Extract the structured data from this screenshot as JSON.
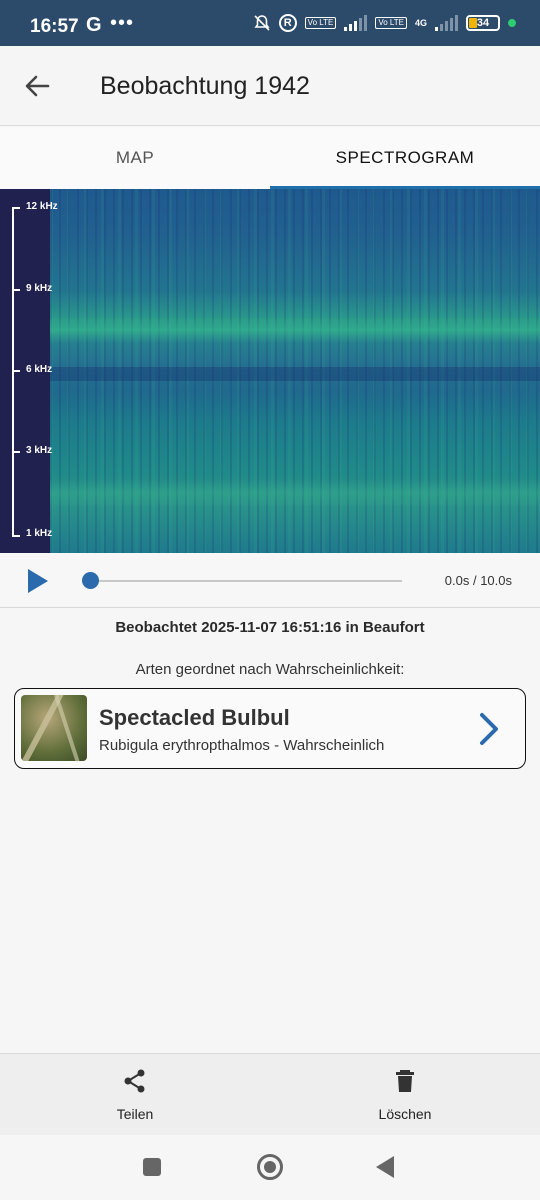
{
  "status_bar": {
    "time": "16:57",
    "app_icon": "G",
    "more": "•••",
    "r_badge": "R",
    "volte1": "Vo LTE",
    "volte2": "Vo LTE",
    "network": "4G",
    "battery": "34"
  },
  "app_bar": {
    "title": "Beobachtung 1942",
    "back_icon": "arrow-left-icon"
  },
  "tabs": [
    {
      "label": "MAP",
      "active": false
    },
    {
      "label": "SPECTROGRAM",
      "active": true
    }
  ],
  "spectrogram": {
    "frequency_labels": [
      "12 kHz",
      "9 kHz",
      "6 kHz",
      "3 kHz",
      "1 kHz"
    ]
  },
  "player": {
    "time": "0.0s / 10.0s",
    "progress": 0.0
  },
  "observation": {
    "observed_text": "Beobachtet 2025-11-07 16:51:16 in Beaufort",
    "sorted_label": "Arten geordnet nach Wahrscheinlichkeit:"
  },
  "species": [
    {
      "common_name": "Spectacled Bulbul",
      "scientific_line": "Rubigula erythropthalmos - Wahrscheinlich"
    }
  ],
  "bottom_actions": {
    "share_label": "Teilen",
    "delete_label": "Löschen"
  },
  "colors": {
    "accent": "#1f6faa",
    "status_bar": "#2c4a6a",
    "play": "#2a6aad"
  }
}
